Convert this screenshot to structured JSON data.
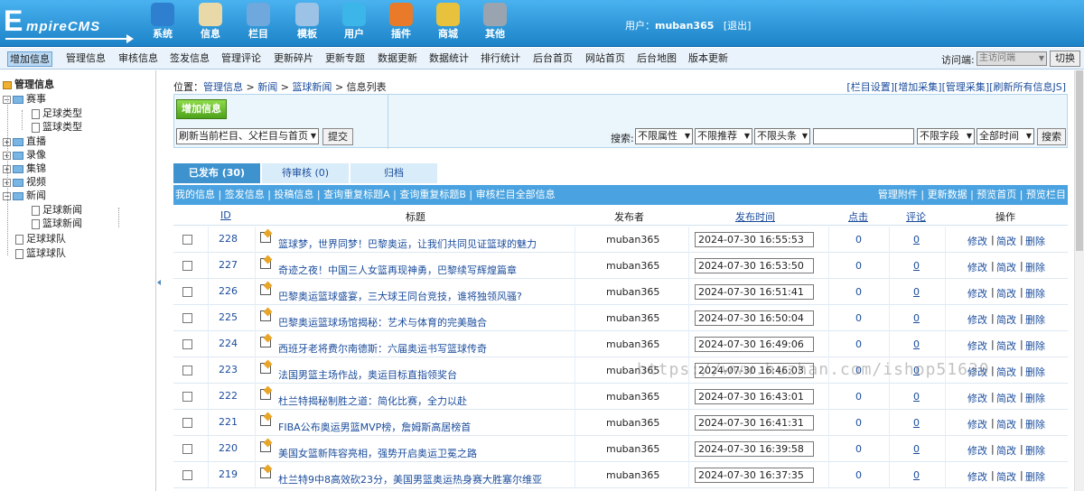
{
  "logo": {
    "big": "E",
    "small": "mpireCMS"
  },
  "topnav": [
    {
      "label": "系统",
      "icon": "globe-icon",
      "color": "#2f7fd0"
    },
    {
      "label": "信息",
      "icon": "edit-document-icon",
      "color": "#e9d9a8"
    },
    {
      "label": "栏目",
      "icon": "folder-icon",
      "color": "#6ea8dc"
    },
    {
      "label": "模板",
      "icon": "template-window-icon",
      "color": "#9cc2e6"
    },
    {
      "label": "用户",
      "icon": "user-icon",
      "color": "#3cb6e8"
    },
    {
      "label": "插件",
      "icon": "tools-icon",
      "color": "#e87a2a"
    },
    {
      "label": "商城",
      "icon": "card-icon",
      "color": "#e8c23c"
    },
    {
      "label": "其他",
      "icon": "gear-icon",
      "color": "#9aa4b0"
    }
  ],
  "user": {
    "prefix": "用户：",
    "name": "muban365",
    "logout": "[退出]"
  },
  "menubar": {
    "items": [
      "增加信息",
      "管理信息",
      "审核信息",
      "签发信息",
      "管理评论",
      "更新碎片",
      "更新专题",
      "数据更新",
      "数据统计",
      "排行统计",
      "后台首页",
      "网站首页",
      "后台地图",
      "版本更新"
    ],
    "access_label": "访问端:",
    "access_value": "主访问端",
    "switch": "切换"
  },
  "sidebar": {
    "title": "管理信息",
    "nodes": [
      "赛事",
      "足球类型",
      "篮球类型",
      "直播",
      "录像",
      "集锦",
      "视频",
      "新闻",
      "足球新闻",
      "篮球新闻",
      "足球球队",
      "篮球球队"
    ]
  },
  "breadcrumb": {
    "label": "位置：",
    "items": [
      "管理信息",
      "新闻",
      "篮球新闻"
    ],
    "sep": ">",
    "current": "信息列表"
  },
  "toplinks": [
    "[栏目设置]",
    "[增加采集]",
    "[管理采集]",
    "[刷新所有信息JS]"
  ],
  "panel": {
    "add": "增加信息",
    "refresh_option": "刷新当前栏目、父栏目与首页",
    "submit": "提交",
    "search_label": "搜索:",
    "filters": [
      "不限属性",
      "不限推荐",
      "不限头条"
    ],
    "field": "不限字段",
    "time": "全部时间",
    "search_btn": "搜索"
  },
  "tabs": [
    "已发布 (30)",
    "待审核 (0)",
    "归档"
  ],
  "listbar": {
    "left": "我的信息 | 签发信息 | 投稿信息 | 查询重复标题A | 查询重复标题B | 审核栏目全部信息",
    "right": "管理附件 | 更新数据 | 预览首页 | 预览栏目"
  },
  "columns": {
    "id": "ID",
    "title": "标题",
    "publisher": "发布者",
    "time": "发布时间",
    "clicks": "点击",
    "comments": "评论",
    "ops": "操作"
  },
  "row_actions": {
    "edit": "修改",
    "quick": "简改",
    "delete": "删除",
    "sep": "|"
  },
  "rows": [
    {
      "id": "228",
      "title": "篮球梦，世界同梦！巴黎奥运，让我们共同见证篮球的魅力",
      "publisher": "muban365",
      "time": "2024-07-30 16:55:53",
      "clicks": "0",
      "comments": "0"
    },
    {
      "id": "227",
      "title": "奇迹之夜！中国三人女篮再现神勇，巴黎续写辉煌篇章",
      "publisher": "muban365",
      "time": "2024-07-30 16:53:50",
      "clicks": "0",
      "comments": "0"
    },
    {
      "id": "226",
      "title": "巴黎奥运篮球盛宴，三大球王同台竞技，谁将独领风骚?",
      "publisher": "muban365",
      "time": "2024-07-30 16:51:41",
      "clicks": "0",
      "comments": "0"
    },
    {
      "id": "225",
      "title": "巴黎奥运篮球场馆揭秘：艺术与体育的完美融合",
      "publisher": "muban365",
      "time": "2024-07-30 16:50:04",
      "clicks": "0",
      "comments": "0"
    },
    {
      "id": "224",
      "title": "西班牙老将费尔南德斯：六届奥运书写篮球传奇",
      "publisher": "muban365",
      "time": "2024-07-30 16:49:06",
      "clicks": "0",
      "comments": "0"
    },
    {
      "id": "223",
      "title": "法国男篮主场作战，奥运目标直指领奖台",
      "publisher": "muban365",
      "time": "2024-07-30 16:46:03",
      "clicks": "0",
      "comments": "0"
    },
    {
      "id": "222",
      "title": "杜兰特揭秘制胜之道：简化比赛，全力以赴",
      "publisher": "muban365",
      "time": "2024-07-30 16:43:01",
      "clicks": "0",
      "comments": "0"
    },
    {
      "id": "221",
      "title": "FIBA公布奥运男篮MVP榜，詹姆斯高居榜首",
      "publisher": "muban365",
      "time": "2024-07-30 16:41:31",
      "clicks": "0",
      "comments": "0"
    },
    {
      "id": "220",
      "title": "美国女篮新阵容亮相，强势开启奥运卫冕之路",
      "publisher": "muban365",
      "time": "2024-07-30 16:39:58",
      "clicks": "0",
      "comments": "0"
    },
    {
      "id": "219",
      "title": "杜兰特9中8高效砍23分，美国男篮奥运热身赛大胜塞尔维亚",
      "publisher": "muban365",
      "time": "2024-07-30 16:37:35",
      "clicks": "0",
      "comments": "0"
    }
  ],
  "watermark": "https://www.huzhan.com/ishop51630"
}
